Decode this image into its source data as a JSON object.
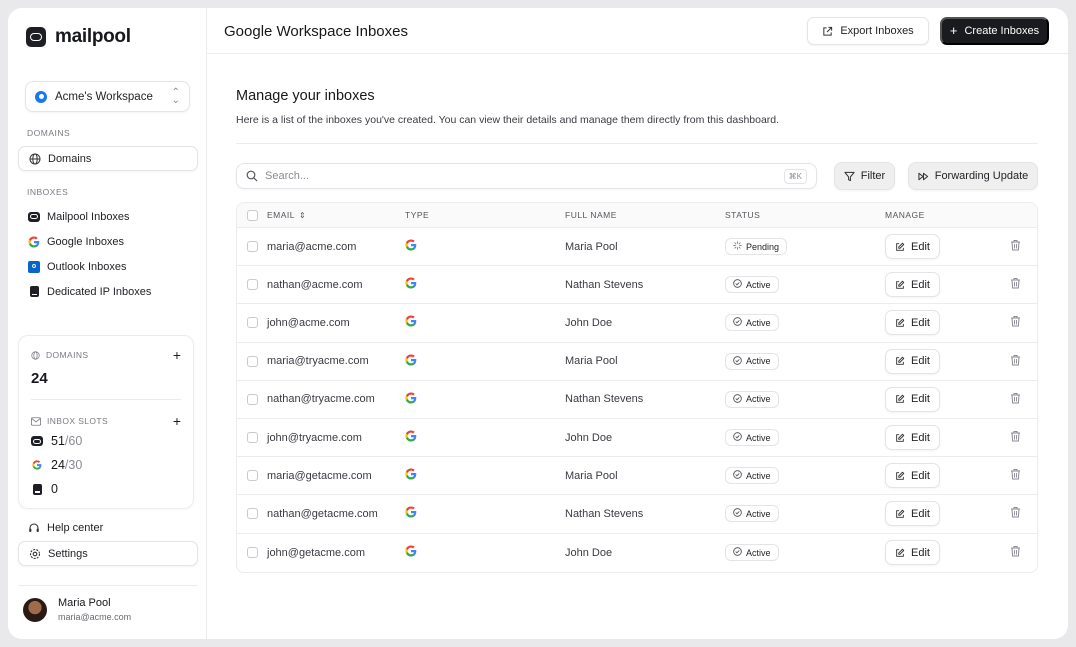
{
  "brand": {
    "name": "mailpool"
  },
  "workspace": {
    "name": "Acme's Workspace"
  },
  "sidebar": {
    "domains_label": "DOMAINS",
    "domains_item": "Domains",
    "inboxes_label": "INBOXES",
    "inbox_items": [
      {
        "label": "Mailpool Inboxes",
        "icon": "mailpool-icon"
      },
      {
        "label": "Google Inboxes",
        "icon": "google-icon"
      },
      {
        "label": "Outlook Inboxes",
        "icon": "outlook-icon"
      },
      {
        "label": "Dedicated IP Inboxes",
        "icon": "server-icon"
      }
    ],
    "stats": {
      "domains_label": "DOMAINS",
      "domains_count": "24",
      "slots_label": "INBOX SLOTS",
      "slots": [
        {
          "used": "51",
          "total": "/60",
          "icon": "mailpool-icon"
        },
        {
          "used": "24",
          "total": "/30",
          "icon": "google-icon"
        },
        {
          "used": "0",
          "total": "",
          "icon": "server-icon"
        }
      ]
    },
    "help": "Help center",
    "settings": "Settings",
    "user": {
      "name": "Maria Pool",
      "email": "maria@acme.com"
    }
  },
  "header": {
    "title": "Google Workspace Inboxes",
    "export_label": "Export Inboxes",
    "create_label": "Create Inboxes"
  },
  "main": {
    "heading": "Manage your inboxes",
    "subheading": "Here is a list of the inboxes you've created. You can view their details and manage them directly from this dashboard.",
    "search_placeholder": "Search...",
    "search_shortcut": "⌘K",
    "filter_label": "Filter",
    "forwarding_label": "Forwarding Update"
  },
  "table": {
    "columns": [
      "EMAIL",
      "TYPE",
      "FULL NAME",
      "STATUS",
      "MANAGE"
    ],
    "edit_label": "Edit",
    "rows": [
      {
        "email": "maria@acme.com",
        "name": "Maria Pool",
        "status": "Pending"
      },
      {
        "email": "nathan@acme.com",
        "name": "Nathan Stevens",
        "status": "Active"
      },
      {
        "email": "john@acme.com",
        "name": "John Doe",
        "status": "Active"
      },
      {
        "email": "maria@tryacme.com",
        "name": "Maria Pool",
        "status": "Active"
      },
      {
        "email": "nathan@tryacme.com",
        "name": "Nathan Stevens",
        "status": "Active"
      },
      {
        "email": "john@tryacme.com",
        "name": "John Doe",
        "status": "Active"
      },
      {
        "email": "maria@getacme.com",
        "name": "Maria Pool",
        "status": "Active"
      },
      {
        "email": "nathan@getacme.com",
        "name": "Nathan Stevens",
        "status": "Active"
      },
      {
        "email": "john@getacme.com",
        "name": "John Doe",
        "status": "Active"
      }
    ]
  },
  "colors": {
    "primary_button": "#1a1b1f",
    "workspace_dot": "#1877f2",
    "outlook": "#0a64c8"
  }
}
